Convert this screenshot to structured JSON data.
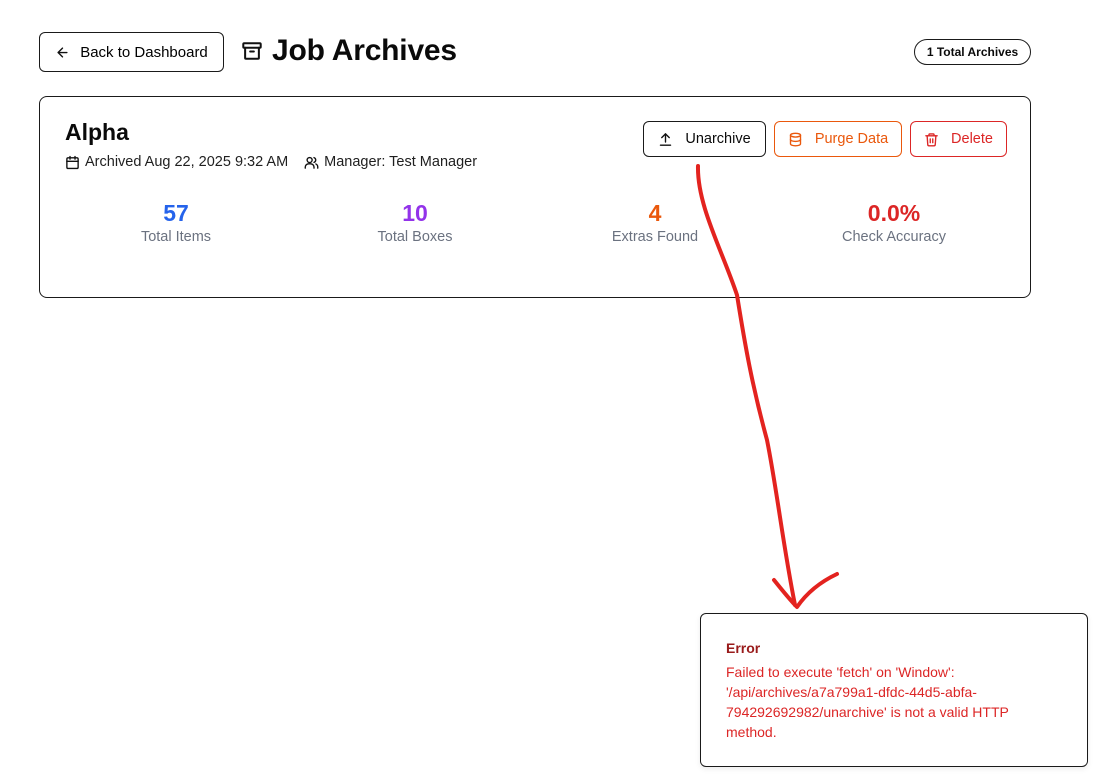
{
  "header": {
    "back_label": "Back to Dashboard",
    "title": "Job Archives",
    "badge": "1 Total Archives"
  },
  "archive": {
    "name": "Alpha",
    "archived": "Archived Aug 22, 2025 9:32 AM",
    "manager": "Manager: Test Manager",
    "actions": {
      "unarchive": "Unarchive",
      "purge": "Purge Data",
      "delete": "Delete"
    },
    "stats": [
      {
        "value": "57",
        "label": "Total Items",
        "color": "#2563eb"
      },
      {
        "value": "10",
        "label": "Total Boxes",
        "color": "#9333ea"
      },
      {
        "value": "4",
        "label": "Extras Found",
        "color": "#ea580c"
      },
      {
        "value": "0.0%",
        "label": "Check Accuracy",
        "color": "#dc2626"
      }
    ]
  },
  "toast": {
    "title": "Error",
    "message": "Failed to execute 'fetch' on 'Window': '/api/archives/a7a799a1-dfdc-44d5-abfa-794292692982/unarchive' is not a valid HTTP method."
  },
  "colors": {
    "annotation": "#e3231f",
    "orange": "#ea580c",
    "red": "#dc2626"
  },
  "icons": {
    "back": "arrow-left-icon",
    "title": "archive-box-icon",
    "archived": "calendar-icon",
    "manager": "users-icon",
    "unarchive": "upload-icon",
    "purge": "database-icon",
    "delete": "trash-icon"
  }
}
